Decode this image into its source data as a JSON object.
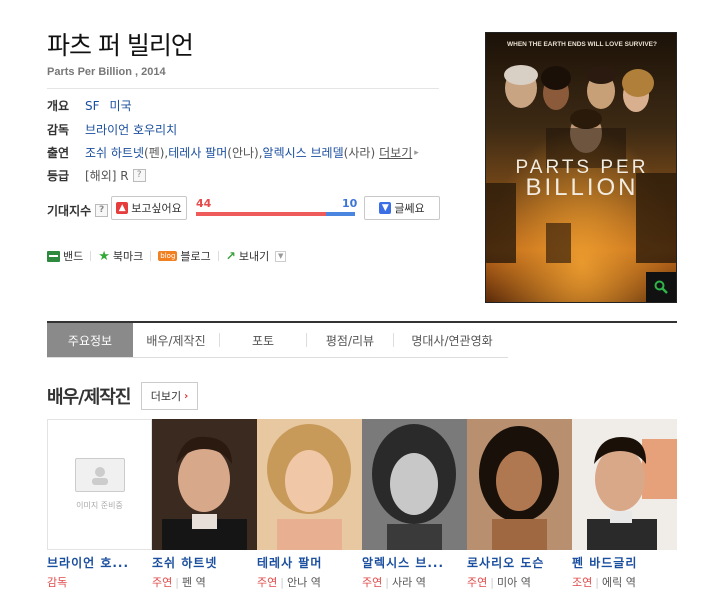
{
  "movie": {
    "title": "파츠 퍼 빌리언",
    "subtitle": "Parts Per Billion , 2014"
  },
  "info": {
    "overview_label": "개요",
    "genre": "SF",
    "country": "미국",
    "director_label": "감독",
    "director": "브라이언 호우리치",
    "cast_label": "출연",
    "cast_text": "조쉬 하트넷(",
    "cast_1_role": "펜",
    "cast_mid1": "), 테레사 팔머(",
    "cast_2_role": "안나",
    "cast_mid2": "), 알렉시스 브레델(",
    "cast_3_role": "사라",
    "cast_end": ")",
    "more_label": "더보기",
    "rating_label": "등급",
    "rating_value": "[해외] R",
    "help": "?"
  },
  "expect": {
    "label": "기대지수",
    "like_button": "보고싶어요",
    "dislike_button": "글쎄요",
    "like_count": "44",
    "dislike_count": "10",
    "like_ratio": 0.815
  },
  "share": {
    "band": "밴드",
    "bookmark": "북마크",
    "blog": "블로그",
    "send": "보내기",
    "blog_badge": "blog"
  },
  "poster": {
    "tagline": "WHEN THE EARTH ENDS WILL LOVE SURVIVE?",
    "title_line1": "PARTS PER",
    "title_line2": "BILLION"
  },
  "tabs": [
    "주요정보",
    "배우/제작진",
    "포토",
    "평점/리뷰",
    "명대사/연관영화"
  ],
  "cast_section": {
    "title": "배우/제작진",
    "more": "더보기",
    "noimg_text": "이미지 준비중",
    "people": [
      {
        "name": "브라이언 호...",
        "type": "감독",
        "role": ""
      },
      {
        "name": "조쉬 하트넷",
        "type": "주연",
        "role": "펜 역"
      },
      {
        "name": "테레사 팔머",
        "type": "주연",
        "role": "안나 역"
      },
      {
        "name": "알렉시스 브...",
        "type": "주연",
        "role": "사라 역"
      },
      {
        "name": "로사리오 도슨",
        "type": "주연",
        "role": "미아 역"
      },
      {
        "name": "펜 바드글리",
        "type": "조연",
        "role": "에릭 역"
      }
    ]
  },
  "colors": {
    "link_blue": "#1a4e9e",
    "like_red": "#ef5b5b",
    "dislike_blue": "#4a85e0",
    "active_tab": "#8a8a8a"
  }
}
